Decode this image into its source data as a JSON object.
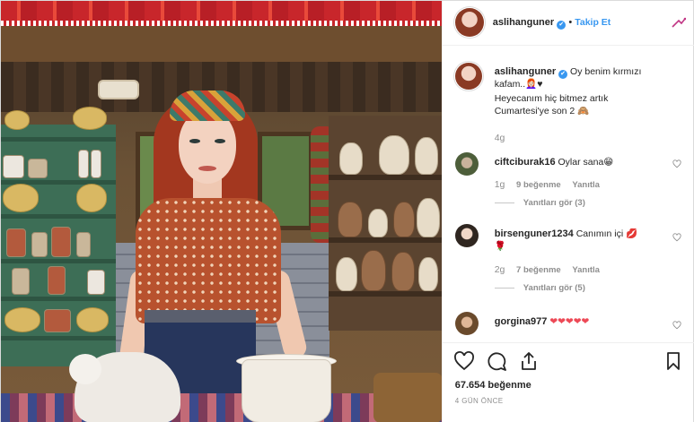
{
  "header": {
    "username": "aslihanguner",
    "verified_mark": "✔",
    "separator": "•",
    "follow_label": "Takip Et",
    "more_icon": "more-options-icon"
  },
  "caption": {
    "username": "aslihanguner",
    "text_line1": "Oy benim kırmızı",
    "text_line2": "kafam..👩🏻‍🦰♥",
    "text_line3": "Heyecanım hiç bitmez artık",
    "text_line4": "Cumartesi'ye son 2 🙈",
    "time": "4g"
  },
  "comments": [
    {
      "username": "ciftciburak16",
      "text": "Oylar sana😁",
      "time": "1g",
      "likes": "9 beğenme",
      "reply_label": "Yanıtla",
      "view_replies": "Yanıtları gör (3)"
    },
    {
      "username": "birsenguner1234",
      "text": "Canımın içi 💋",
      "text_extra": "🌹",
      "time": "2g",
      "likes": "7 beğenme",
      "reply_label": "Yanıtla",
      "view_replies": "Yanıtları gör (5)"
    },
    {
      "username": "gorgina977",
      "text": "❤❤❤❤❤"
    }
  ],
  "footer": {
    "likes": "67.654 beğenme",
    "time_ago": "4 GÜN ÖNCE"
  },
  "colors": {
    "link_blue": "#3897f0",
    "verified_blue": "#3897f0",
    "like_red": "#ed4956",
    "muted_text": "#8e8e8e"
  }
}
